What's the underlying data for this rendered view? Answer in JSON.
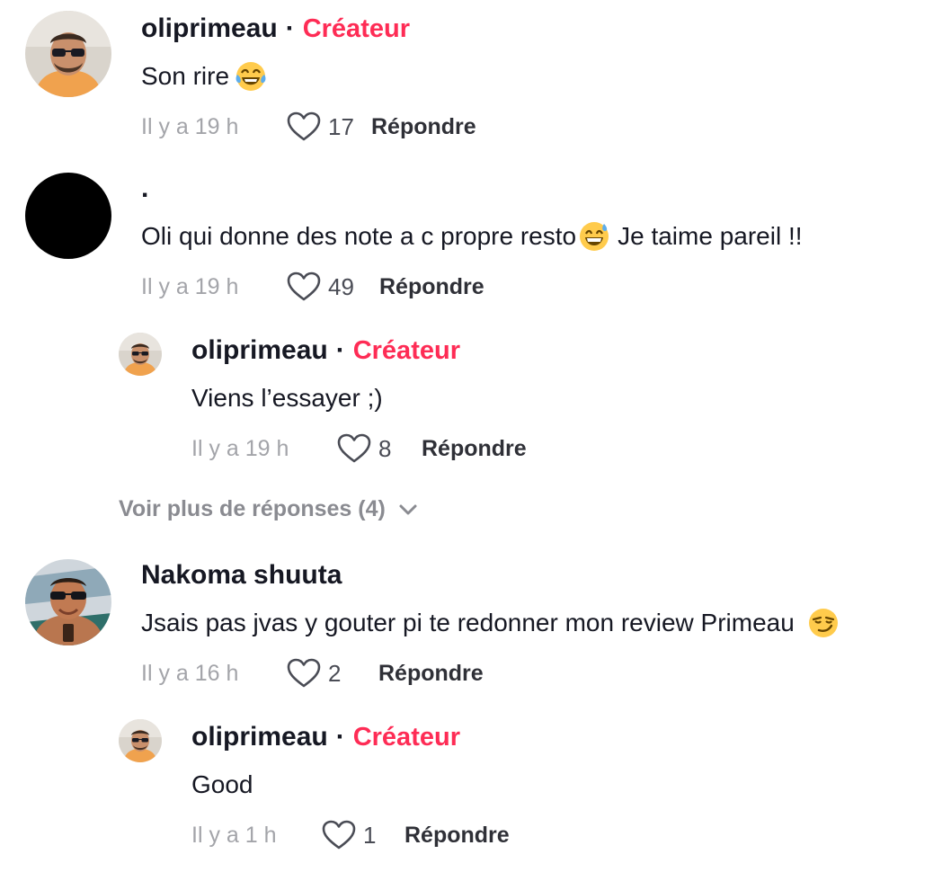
{
  "colors": {
    "creator": "#fe2c55",
    "text": "#161823",
    "muted": "#a3a4a9"
  },
  "comments": [
    {
      "username": "oliprimeau",
      "badge": "Créateur",
      "text": "Son rire",
      "emoji": "tears-of-joy-emoji",
      "time": "Il y a 19 h",
      "likes": "17",
      "reply": "Répondre"
    },
    {
      "username": ".",
      "text": "Oli qui donne des note a c propre resto",
      "emoji": "grinning-sweat-emoji",
      "text_after": " Je taime pareil !!",
      "time": "Il y a 19 h",
      "likes": "49",
      "reply": "Répondre",
      "replies": [
        {
          "username": "oliprimeau",
          "badge": "Créateur",
          "text": "Viens l’essayer ;)",
          "time": "Il y a 19 h",
          "likes": "8",
          "reply": "Répondre"
        }
      ],
      "more_replies": "Voir plus de réponses (4)"
    },
    {
      "username": "Nakoma shuuta",
      "text": "Jsais pas jvas y gouter pi te redonner mon review Primeau ",
      "emoji": "smirking-emoji",
      "time": "Il y a 16 h",
      "likes": "2",
      "reply": "Répondre",
      "replies": [
        {
          "username": "oliprimeau",
          "badge": "Créateur",
          "text": "Good",
          "time": "Il y a 1 h",
          "likes": "1",
          "reply": "Répondre"
        }
      ]
    }
  ]
}
